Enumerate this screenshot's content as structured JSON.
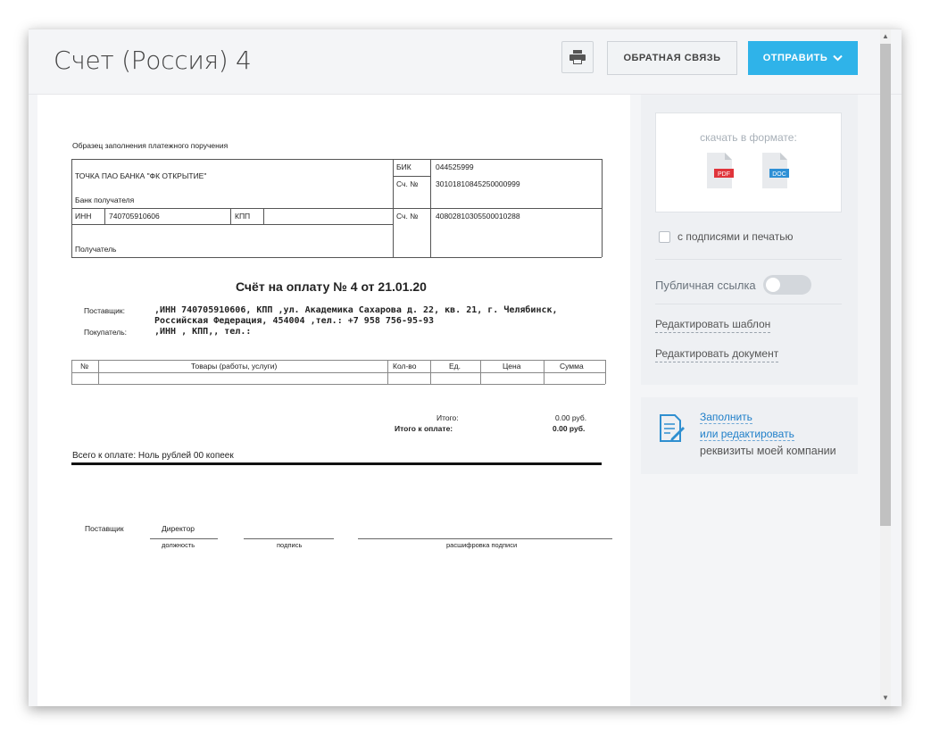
{
  "header": {
    "title": "Счет (Россия) 4",
    "feedback_label": "ОБРАТНАЯ СВЯЗЬ",
    "send_label": "ОТПРАВИТЬ"
  },
  "doc": {
    "sample_title": "Образец заполнения платежного поручения",
    "bank_name": "ТОЧКА ПАО БАНКА \"ФК ОТКРЫТИЕ\"",
    "bank_label": "Банк получателя",
    "bik_label": "БИК",
    "bik_value": "044525999",
    "acc_label1": "Сч. №",
    "acc_value1": "30101810845250000999",
    "inn_label": "ИНН",
    "inn_value": "740705910606",
    "kpp_label": "КПП",
    "acc_label2": "Сч. №",
    "acc_value2": "40802810305500010288",
    "recipient_label": "Получатель",
    "invoice_title": "Счёт на оплату № 4 от 21.01.20",
    "supplier_label": "Поставщик:",
    "supplier_line1": ",ИНН 740705910606, КПП ,ул. Академика Сахарова д. 22,  кв. 21, г. Челябинск,",
    "supplier_line2": "Российская Федерация, 454004 ,тел.: +7 958 756-95-93",
    "buyer_label": "Покупатель:",
    "buyer_value": ",ИНН , КПП,, тел.:",
    "table_headers": [
      "№",
      "Товары (работы, услуги)",
      "Кол-во",
      "Ед.",
      "Цена",
      "Сумма"
    ],
    "total_label": "Итого:",
    "total_value": "0.00 руб.",
    "total_pay_label": "Итого к оплате:",
    "total_pay_value": "0.00 руб.",
    "grand_total": "Всего к оплате: Ноль рублей 00 копеек",
    "sign_supplier": "Поставщик",
    "sign_director": "Директор",
    "sign_position": "должность",
    "sign_signature": "подпись",
    "sign_decode": "расшифровка подписи"
  },
  "sidebar": {
    "download_label": "скачать в формате:",
    "pdf_label": "PDF",
    "doc_label": "DOC",
    "pdf_color": "#e0343b",
    "doc_color": "#2d8fd5",
    "signatures_checkbox": "с подписями и печатью",
    "public_link_label": "Публичная ссылка",
    "public_link_on": false,
    "edit_template": "Редактировать шаблон",
    "edit_document": "Редактировать документ",
    "fill_link_1": "Заполнить",
    "fill_link_2": "или редактировать",
    "fill_text": "реквизиты моей компании"
  },
  "icons": {
    "print": "printer-icon",
    "send_dropdown": "chevron-down-icon",
    "fill": "edit-document-icon"
  },
  "colors": {
    "accent": "#2fb3e9",
    "link": "#1f7fc9"
  }
}
